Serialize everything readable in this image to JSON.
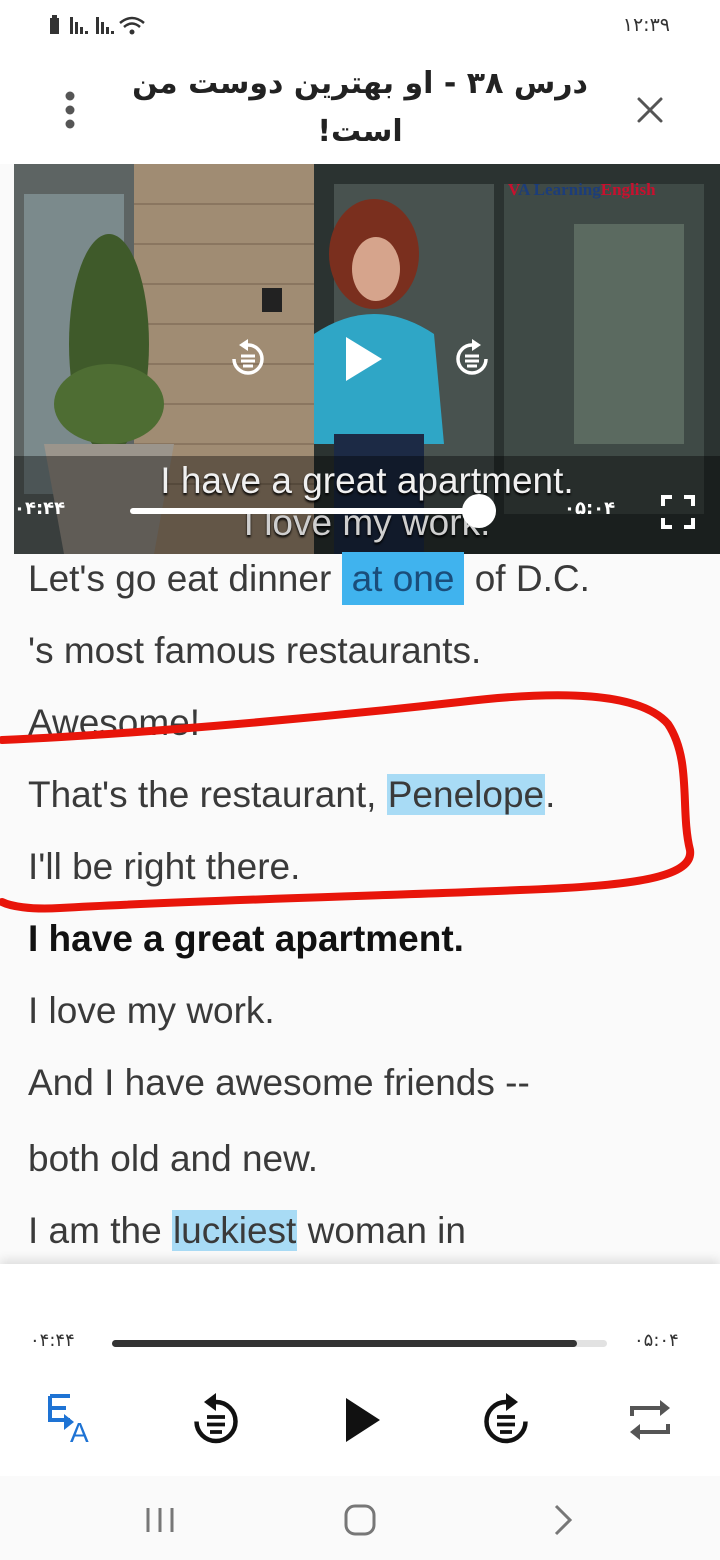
{
  "status_bar": {
    "time": "۱۲:۳۹"
  },
  "header": {
    "title": "درس ۳۸ - او بهترین دوست من است!"
  },
  "video": {
    "brand_logo": "VOA Learning English",
    "subtitle_line1": "I have a great apartment.",
    "subtitle_line2": "I love my work.",
    "elapsed": "۰۴:۴۴",
    "duration": "۰۵:۰۴",
    "progress": 0.94
  },
  "transcript": {
    "lines": [
      [
        "Let's go eat dinner ",
        {
          "hl": "at one",
          "strong": true
        },
        " of D.C."
      ],
      [
        "'s most famous restaurants."
      ],
      [
        "Awesome!"
      ],
      [
        "That's the restaurant, ",
        {
          "hl": "Penelope"
        },
        "."
      ],
      [
        "I'll be right there."
      ],
      [
        "I have a great apartment."
      ],
      [
        "I love my work."
      ],
      [
        "And I have awesome friends --"
      ],
      [
        "both old and new."
      ],
      [
        "I am the ",
        {
          "hl": "luckiest"
        },
        " woman in"
      ]
    ],
    "active_line": 5
  },
  "player": {
    "elapsed": "۰۴:۴۴",
    "duration": "۰۵:۰۴",
    "progress": 0.94
  },
  "colors": {
    "accent": "#1e73d4",
    "highlight": "#a8dbf5",
    "highlight_strong": "#40b3ee",
    "annotation": "#e8150a"
  }
}
